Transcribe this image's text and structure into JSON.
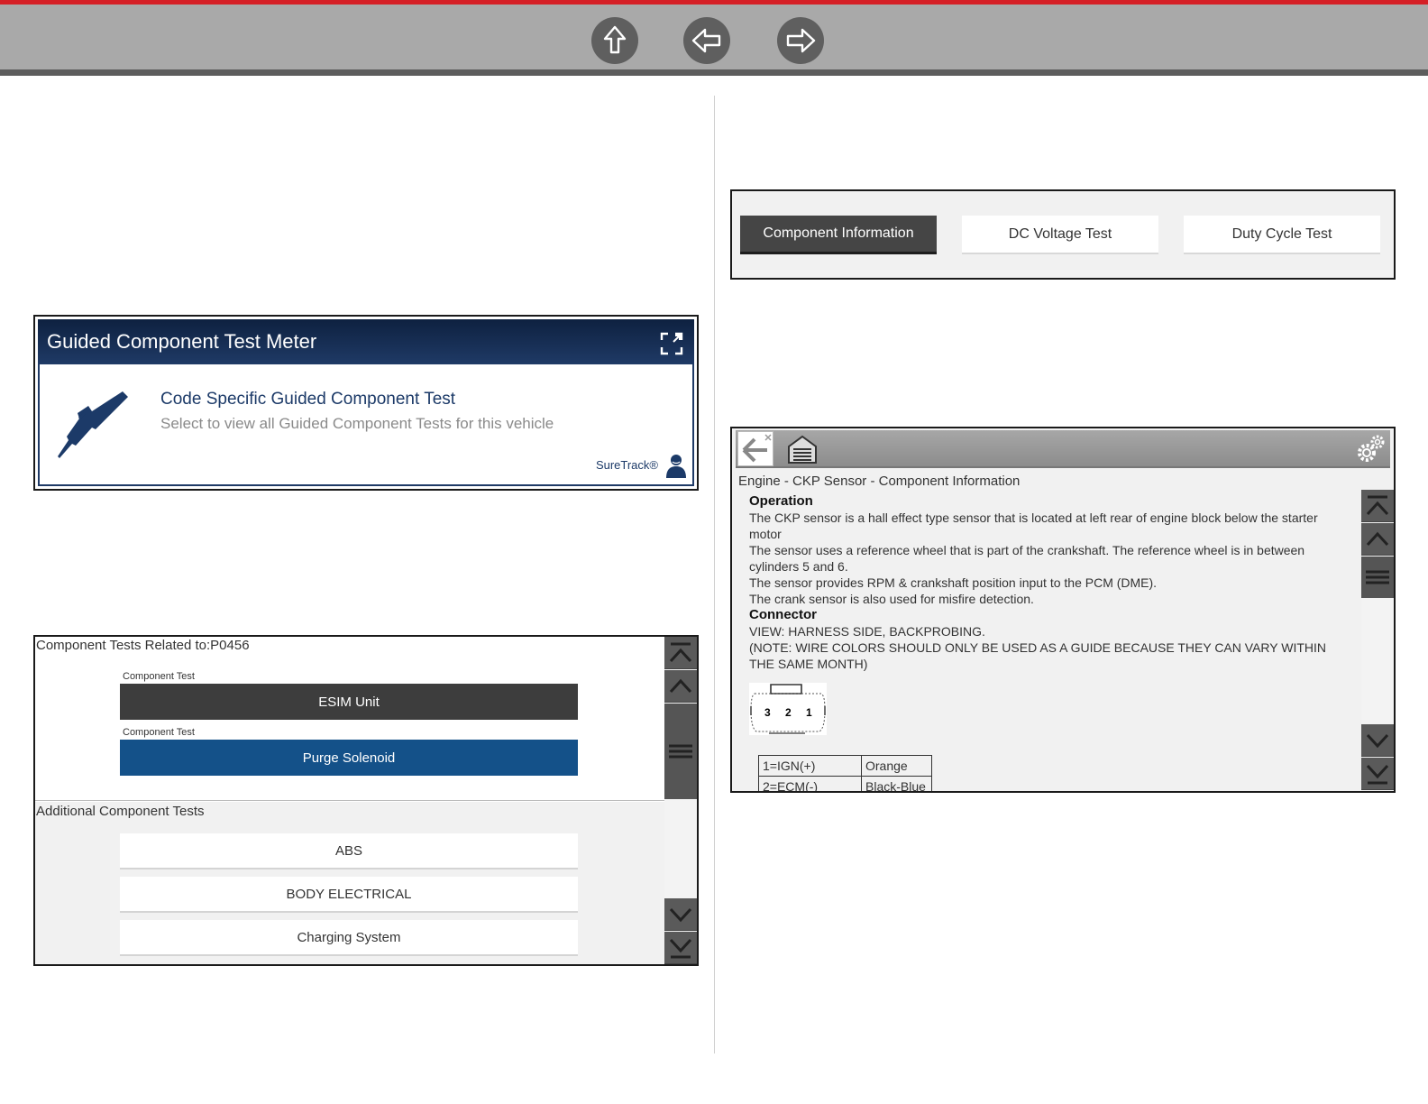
{
  "nav": {
    "up_icon": "up-arrow-icon",
    "back_icon": "left-arrow-icon",
    "forward_icon": "right-arrow-icon",
    "accent_color": "#d51f26"
  },
  "gctm": {
    "title": "Guided Component Test Meter",
    "heading": "Code Specific Guided Component Test",
    "subtitle": "Select to view all Guided Component Tests for this vehicle",
    "suretrack": "SureTrack®"
  },
  "component_tests": {
    "related_title": "Component Tests Related to:P0456",
    "items": [
      {
        "label": "Component Test",
        "name": "ESIM Unit"
      },
      {
        "label": "Component Test",
        "name": "Purge Solenoid"
      }
    ],
    "additional_title": "Additional Component Tests",
    "additional": [
      "ABS",
      "BODY ELECTRICAL",
      "Charging System"
    ]
  },
  "tabs": [
    "Component Information",
    "DC Voltage Test",
    "Duty Cycle Test"
  ],
  "viewer": {
    "path": "Engine - CKP Sensor - Component Information",
    "operation_heading": "Operation",
    "operation_lines": [
      "The CKP sensor is a hall effect type sensor that is located at left rear of engine block below the starter motor",
      "The sensor uses a reference wheel that is part of the crankshaft. The reference wheel is in between cylinders 5 and 6.",
      "The sensor provides RPM & crankshaft position input to the PCM (DME).",
      "The crank sensor is also used for misfire detection."
    ],
    "connector_heading": "Connector",
    "connector_lines": [
      "VIEW: HARNESS SIDE, BACKPROBING.",
      "(NOTE: WIRE COLORS SHOULD ONLY BE USED AS A GUIDE BECAUSE THEY CAN VARY WITHIN THE SAME MONTH)"
    ],
    "pins": [
      "3",
      "2",
      "1"
    ],
    "pin_table": [
      {
        "pin": "1=IGN(+)",
        "color": "Orange"
      },
      {
        "pin": "2=ECM(-)",
        "color": "Black-Blue"
      }
    ]
  }
}
